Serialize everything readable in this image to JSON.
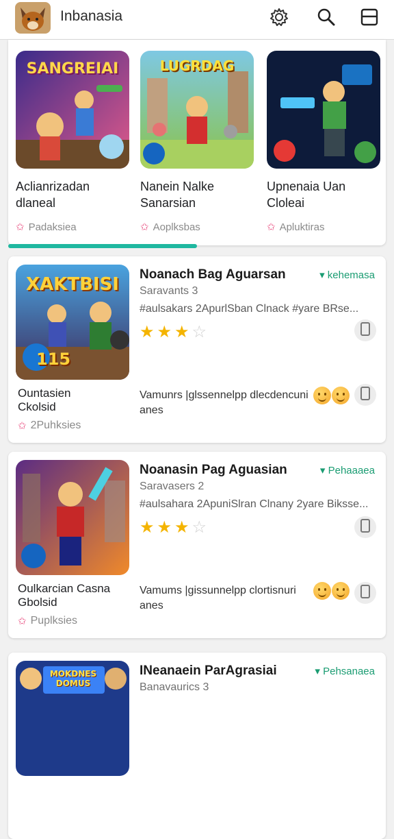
{
  "app": {
    "title": "Inbanasia"
  },
  "carousel": {
    "tiles": [
      {
        "art_text": "SANGREIAI",
        "title": "Aclianrizadan\ndlaneal",
        "meta": "Padaksiea"
      },
      {
        "art_text": "LUGRDAG",
        "title": "Nanein Nalke\nSanarsian",
        "meta": "Aoplksbas"
      },
      {
        "art_text": "",
        "title": "Upnenaia Uan\nCloleai",
        "meta": "Apluktiras"
      }
    ]
  },
  "list": [
    {
      "art_text": "XAKTBISI",
      "art_badge": "115",
      "title": "Noanach Bag Aguarsan",
      "tag": "kehemasa",
      "sub": "Saravants 3",
      "desc": "#aulsakars 2ApurlSban Clnack #yare BRse...",
      "rating": 3,
      "name": "Ountasien\nCkolsid",
      "meta": "2Puhksies",
      "promo": "Vamunrs |glssennelpp dlecdencuni anes"
    },
    {
      "art_text": "",
      "art_badge": "",
      "title": "Noanasin Pag Aguasian",
      "tag": "Pehaaaea",
      "sub": "Saravasers 2",
      "desc": "#aulsahara 2ApuniSlran Clnany 2yare Biksse...",
      "rating": 3,
      "name": "Oulkarcian Casna\nGbolsid",
      "meta": "Puplksies",
      "promo": "Vamums |gissunnelpp clortisnuri anes"
    },
    {
      "art_text": "MOKDNES DOMUS",
      "art_badge": "",
      "title": "INeanaein ParAgrasiai",
      "tag": "Pehsanaea",
      "sub": "Banavaurics 3",
      "desc": "",
      "rating": 0,
      "name": "",
      "meta": "",
      "promo": ""
    }
  ],
  "colors": {
    "accent": "#1fb8a0",
    "star": "#f4b400",
    "pink": "#e8457a",
    "tag": "#1a9c72"
  },
  "icons": [
    "settings-gear-icon",
    "search-icon",
    "menu-panel-icon",
    "star-icon",
    "phone-device-icon"
  ]
}
